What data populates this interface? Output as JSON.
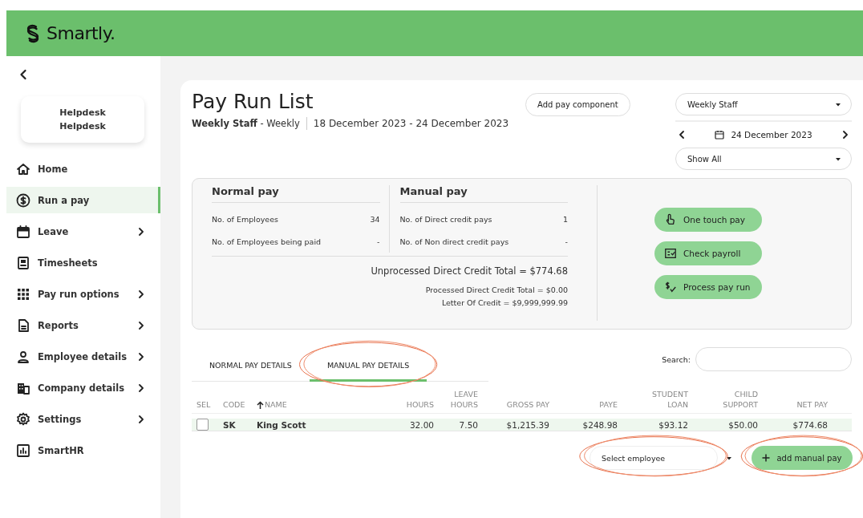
{
  "header": {
    "logo": "Smartly."
  },
  "sidebar": {
    "profile": {
      "name": "Helpdesk",
      "role": "Helpdesk"
    },
    "items": [
      {
        "label": "Home",
        "selected": false,
        "expandable": false
      },
      {
        "label": "Run a pay",
        "selected": true,
        "expandable": false
      },
      {
        "label": "Leave",
        "selected": false,
        "expandable": true
      },
      {
        "label": "Timesheets",
        "selected": false,
        "expandable": false
      },
      {
        "label": "Pay run options",
        "selected": false,
        "expandable": true
      },
      {
        "label": "Reports",
        "selected": false,
        "expandable": true
      },
      {
        "label": "Employee details",
        "selected": false,
        "expandable": true
      },
      {
        "label": "Company details",
        "selected": false,
        "expandable": true
      },
      {
        "label": "Settings",
        "selected": false,
        "expandable": true
      },
      {
        "label": "SmartHR",
        "selected": false,
        "expandable": false
      }
    ]
  },
  "page": {
    "title": "Pay Run List",
    "subtitle": "**Weekly Staff** - Weekly",
    "period": "18 December 2023 - 24 December 2023",
    "add_button": "Add pay component",
    "group_select": "Weekly Staff",
    "date": "24 December 2023",
    "filter_select": "Show All"
  },
  "summary": {
    "columns": [
      {
        "title": "Normal pay",
        "rows": [
          {
            "label": "No. of Employees",
            "value": "34"
          },
          {
            "label": "No. of Employees being paid",
            "value": "-"
          }
        ]
      },
      {
        "title": "Manual pay",
        "rows": [
          {
            "label": "No. of Direct credit pays",
            "value": "1"
          },
          {
            "label": "No. of Non direct credit pays",
            "value": "-"
          }
        ]
      }
    ],
    "totals": [
      {
        "text": "Unprocessed Direct Credit Total  =  $774.68",
        "major": true
      },
      {
        "text": "Processed Direct Credit Total  =  $0.00",
        "major": false
      },
      {
        "text": "Letter Of Credit  =  $9,999,999.99",
        "major": false
      }
    ],
    "actions": [
      "One touch pay",
      "Check payroll",
      "Process pay run"
    ]
  },
  "tabs": [
    {
      "label": "NORMAL PAY DETAILS",
      "selected": false,
      "circled": false
    },
    {
      "label": "MANUAL PAY DETAILS",
      "selected": true,
      "circled": true
    }
  ],
  "search": {
    "label": "Search:"
  },
  "table": {
    "columns": [
      {
        "label": "SEL",
        "sorted": false
      },
      {
        "label": "CODE",
        "sorted": false
      },
      {
        "label": "NAME",
        "sorted": true
      },
      {
        "label": "HOURS",
        "sorted": false
      },
      {
        "label": "LEAVE HOURS",
        "sorted": false
      },
      {
        "label": "GROSS PAY",
        "sorted": false
      },
      {
        "label": "PAYE",
        "sorted": false
      },
      {
        "label": "STUDENT LOAN",
        "sorted": false
      },
      {
        "label": "CHILD SUPPORT",
        "sorted": false
      },
      {
        "label": "NET PAY",
        "sorted": false
      }
    ],
    "rows": [
      {
        "checked": false,
        "highlighted": true,
        "cells": [
          "",
          "SK",
          "King Scott",
          "32.00",
          "7.50",
          "$1,215.39",
          "$248.98",
          "$93.12",
          "$50.00",
          "$774.68"
        ]
      }
    ]
  },
  "footer": {
    "employee_select": {
      "placeholder": "Select employee",
      "circled": true
    },
    "add_button": {
      "label": "add manual pay",
      "circled": true
    }
  }
}
